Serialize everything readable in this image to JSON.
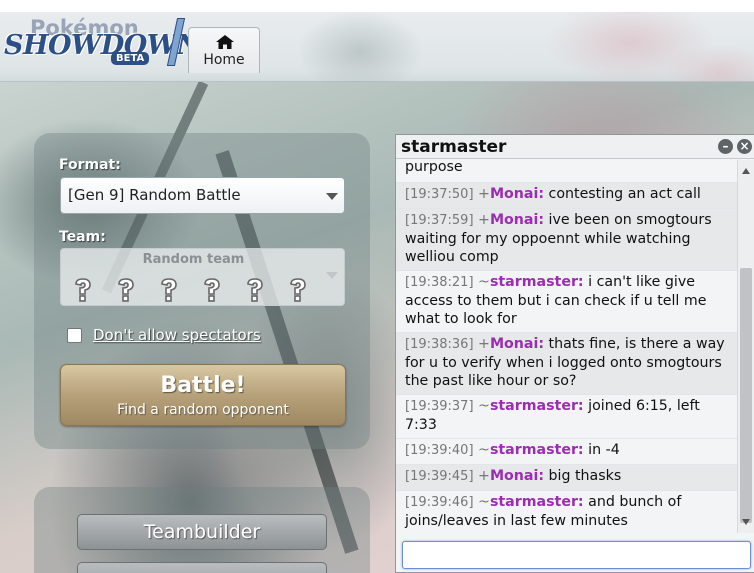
{
  "header": {
    "logo": {
      "top": "Pokémon",
      "main": "SHOWDOWN",
      "badge": "BETA"
    },
    "tabs": [
      {
        "label": "Home",
        "icon": "home-icon"
      }
    ]
  },
  "main_menu": {
    "format_label": "Format:",
    "format_value": "[Gen 9] Random Battle",
    "team_label": "Team:",
    "team_value": "Random team",
    "team_slots": [
      "unknown-pokemon-icon",
      "unknown-pokemon-icon",
      "unknown-pokemon-icon",
      "unknown-pokemon-icon",
      "unknown-pokemon-icon",
      "unknown-pokemon-icon"
    ],
    "spectators_label": "Don't allow spectators",
    "spectators_checked": false,
    "battle_button": {
      "title": "Battle!",
      "subtitle": "Find a random opponent"
    },
    "teambuilder_label": "Teambuilder"
  },
  "chat": {
    "title": "starmaster",
    "input_value": "",
    "colors": {
      "Monai": "#9b2eb0",
      "starmaster": "#9b2eb0"
    },
    "messages": [
      {
        "timestamp": "",
        "rank": "",
        "user": "",
        "text": "purpose"
      },
      {
        "timestamp": "[19:37:50]",
        "rank": "+",
        "user": "Monai:",
        "text": "contesting an act call"
      },
      {
        "timestamp": "[19:37:59]",
        "rank": "+",
        "user": "Monai:",
        "text": "ive been on smogtours waiting for my oppoennt while watching welliou comp"
      },
      {
        "timestamp": "[19:38:21]",
        "rank": "~",
        "user": "starmaster:",
        "text": "i can't like give access to them but i can check if u tell me what to look for"
      },
      {
        "timestamp": "[19:38:36]",
        "rank": "+",
        "user": "Monai:",
        "text": "thats fine, is there a way for u to verify when i logged onto smogtours the past like hour or so?"
      },
      {
        "timestamp": "[19:39:37]",
        "rank": "~",
        "user": "starmaster:",
        "text": "joined 6:15, left 7:33"
      },
      {
        "timestamp": "[19:39:40]",
        "rank": "~",
        "user": "starmaster:",
        "text": "in -4"
      },
      {
        "timestamp": "[19:39:45]",
        "rank": "+",
        "user": "Monai:",
        "text": "big thasks"
      },
      {
        "timestamp": "[19:39:46]",
        "rank": "~",
        "user": "starmaster:",
        "text": "and bunch of joins/leaves in last few minutes"
      }
    ]
  }
}
